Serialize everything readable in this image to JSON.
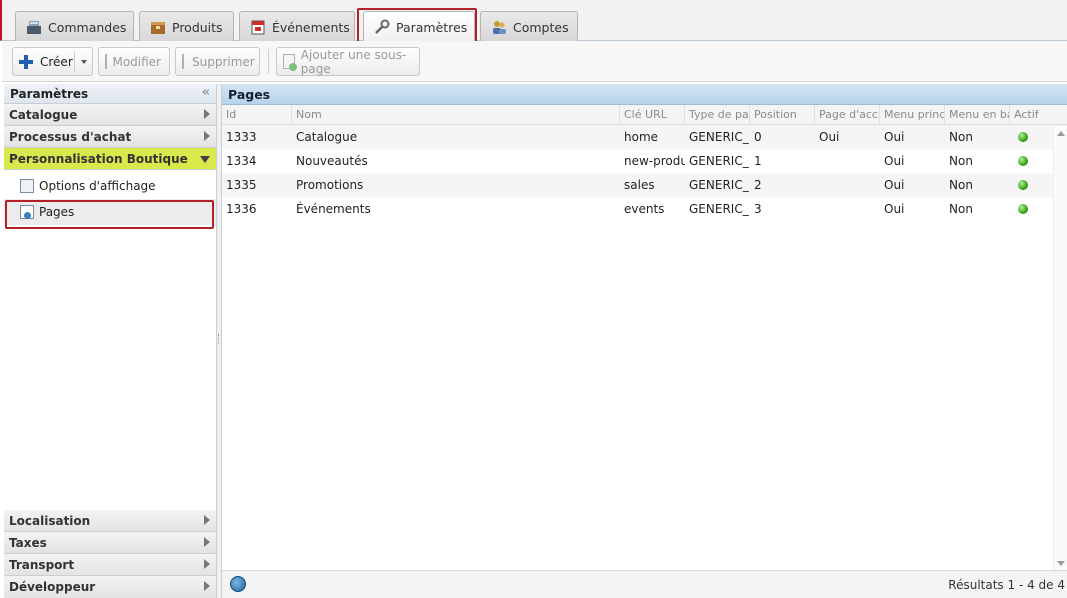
{
  "tabs": [
    {
      "label": "Commandes",
      "icon": "cash-register-icon"
    },
    {
      "label": "Produits",
      "icon": "box-icon"
    },
    {
      "label": "Événements",
      "icon": "calendar-icon"
    },
    {
      "label": "Paramètres",
      "icon": "wrench-icon"
    },
    {
      "label": "Comptes",
      "icon": "users-icon"
    }
  ],
  "toolbar": {
    "create": "Créer",
    "modify": "Modifier",
    "delete": "Supprimer",
    "add_subpage": "Ajouter une sous-page"
  },
  "sidebar": {
    "title": "Paramètres",
    "top_sections": [
      "Catalogue",
      "Processus d'achat"
    ],
    "open_section": "Personnalisation Boutique",
    "subitems": [
      {
        "label": "Options d'affichage",
        "icon": "display-options-icon"
      },
      {
        "label": "Pages",
        "icon": "page-icon"
      }
    ],
    "bottom_sections": [
      "Localisation",
      "Taxes",
      "Transport",
      "Développeur"
    ]
  },
  "grid": {
    "title": "Pages",
    "columns": [
      "Id",
      "Nom",
      "Clé URL",
      "Type de pag",
      "Position",
      "Page d'accu",
      "Menu princi",
      "Menu en ba",
      "Actif"
    ],
    "rows": [
      {
        "id": "1333",
        "nom": "Catalogue",
        "cle": "home",
        "type": "GENERIC_",
        "position": "0",
        "accueil": "Oui",
        "menu_princ": "Oui",
        "menu_bas": "Non",
        "actif": "active-status-icon"
      },
      {
        "id": "1334",
        "nom": "Nouveautés",
        "cle": "new-produ",
        "type": "GENERIC_",
        "position": "1",
        "accueil": "",
        "menu_princ": "Oui",
        "menu_bas": "Non",
        "actif": "active-status-icon"
      },
      {
        "id": "1335",
        "nom": "Promotions",
        "cle": "sales",
        "type": "GENERIC_",
        "position": "2",
        "accueil": "",
        "menu_princ": "Oui",
        "menu_bas": "Non",
        "actif": "active-status-icon"
      },
      {
        "id": "1336",
        "nom": "Événements",
        "cle": "events",
        "type": "GENERIC_",
        "position": "3",
        "accueil": "",
        "menu_princ": "Oui",
        "menu_bas": "Non",
        "actif": "active-status-icon"
      }
    ],
    "results": "Résultats 1 - 4 de 4"
  },
  "colors": {
    "accent_green": "#d9e84b",
    "highlight_red": "#b22028",
    "grid_header": "#b6d2ea"
  }
}
